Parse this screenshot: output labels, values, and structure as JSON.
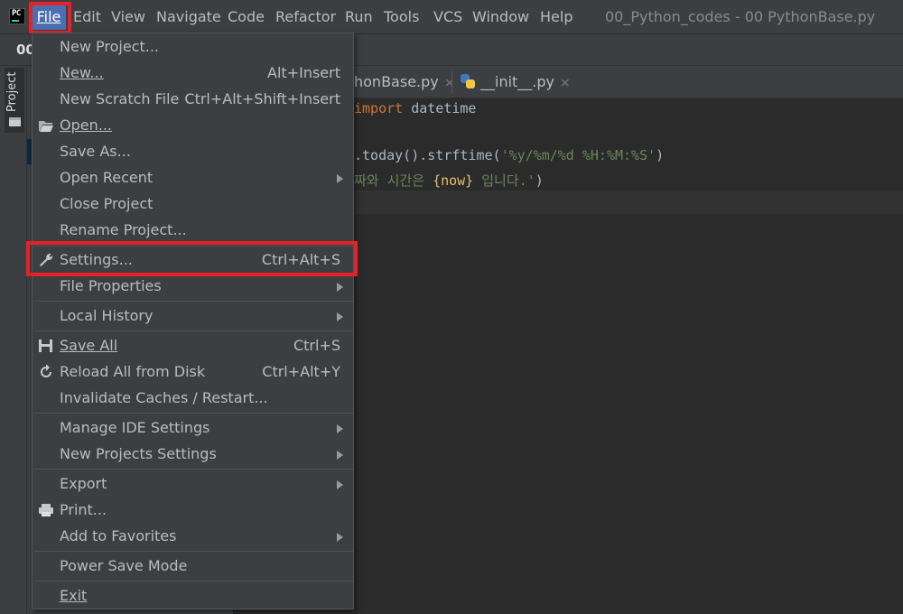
{
  "menubar": {
    "app_icon": "pycharm-logo",
    "app_icon_text": "PC",
    "items": [
      "File",
      "Edit",
      "View",
      "Navigate",
      "Code",
      "Refactor",
      "Run",
      "Tools",
      "VCS",
      "Window",
      "Help"
    ],
    "window_title": "00_Python_codes - 00 PythonBase.py"
  },
  "navbar": {
    "crumb": "00"
  },
  "sidebar": {
    "project_label": "Project",
    "icon": "folder-icon"
  },
  "tabs": [
    {
      "label": "honBase.py",
      "close": "×",
      "icon": "python-file-icon"
    },
    {
      "label": "__init__.py",
      "close": "×",
      "icon": "python-file-icon"
    }
  ],
  "editor": {
    "line1_kw": "import",
    "line1_rest": " datetime",
    "line2_a": ".today().strftime(",
    "line2_str": "'%y/%m/%d %H:%M:%S'",
    "line2_b": ")",
    "line3_str_a": "짜와 시간은 ",
    "line3_fv": "{now}",
    "line3_str_b": " 입니다.'",
    "line3_b": ")"
  },
  "file_menu": {
    "new_project": "New Project...",
    "new": "New...",
    "new_shortcut": "Alt+Insert",
    "new_scratch": "New Scratch File",
    "new_scratch_shortcut": "Ctrl+Alt+Shift+Insert",
    "open": "Open...",
    "save_as": "Save As...",
    "open_recent": "Open Recent",
    "close_project": "Close Project",
    "rename_project": "Rename Project...",
    "settings": "Settings...",
    "settings_shortcut": "Ctrl+Alt+S",
    "file_properties": "File Properties",
    "local_history": "Local History",
    "save_all": "Save All",
    "save_all_shortcut": "Ctrl+S",
    "reload": "Reload All from Disk",
    "reload_shortcut": "Ctrl+Alt+Y",
    "invalidate": "Invalidate Caches / Restart...",
    "manage_ide": "Manage IDE Settings",
    "new_projects_settings": "New Projects Settings",
    "export": "Export",
    "print": "Print...",
    "add_favorites": "Add to Favorites",
    "power_save": "Power Save Mode",
    "exit": "Exit"
  },
  "colors": {
    "menu_bg": "#3c3f41",
    "editor_bg": "#2b2b2b",
    "highlight_box": "#e8202a",
    "selected_menu": "#4b6eaf"
  }
}
